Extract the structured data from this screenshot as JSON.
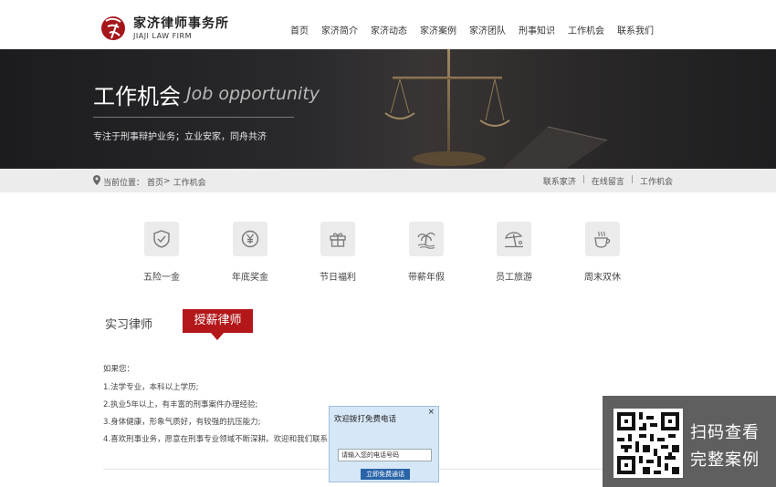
{
  "header": {
    "logo_cn": "家济律师事务所",
    "logo_en": "JIAJI LAW FIRM",
    "logo_seal": "家济",
    "nav": [
      "首页",
      "家济简介",
      "家济动态",
      "家济案例",
      "家济团队",
      "刑事知识",
      "工作机会",
      "联系我们"
    ]
  },
  "banner": {
    "title": "工作机会",
    "title_en": "Job opportunity",
    "subtitle": "专注于刑事辩护业务；立业安家，同舟共济"
  },
  "breadcrumb": {
    "location_label": "当前位置：",
    "home": "首页",
    "separator": ">",
    "current": "工作机会",
    "links": [
      "联系家济",
      "在线留言",
      "工作机会"
    ],
    "link_separator": "|"
  },
  "benefits": [
    {
      "label": "五险一金",
      "icon": "shield-check-icon"
    },
    {
      "label": "年底奖金",
      "icon": "yen-coin-icon"
    },
    {
      "label": "节日福利",
      "icon": "gift-icon"
    },
    {
      "label": "带薪年假",
      "icon": "beach-palm-icon"
    },
    {
      "label": "员工旅游",
      "icon": "umbrella-beach-icon"
    },
    {
      "label": "周末双休",
      "icon": "coffee-cup-icon"
    }
  ],
  "tabs": {
    "intern": "实习律师",
    "hiring": "授薪律师"
  },
  "requirements": {
    "intro": "如果您：",
    "items": [
      "1.法学专业，本科以上学历;",
      "2.执业5年以上，有丰富的刑事案件办理经验;",
      "3.身体健康，形象气质好，有较强的抗压能力;",
      "4.喜欢刑事业务，愿意在刑事专业领域不断深耕。欢迎和我们联系"
    ]
  },
  "popup": {
    "title": "欢迎拨打免费电话",
    "close": "×",
    "input_value": "请输入您的电话号码",
    "button": "立即免费通话"
  },
  "qr_overlay": {
    "line1": "扫码查看",
    "line2": "完整案例"
  },
  "colors": {
    "accent": "#b3171a",
    "banner_dark": "#1c1c1e",
    "popup_bg": "#d6e7f7",
    "popup_button": "#2a64a8"
  }
}
